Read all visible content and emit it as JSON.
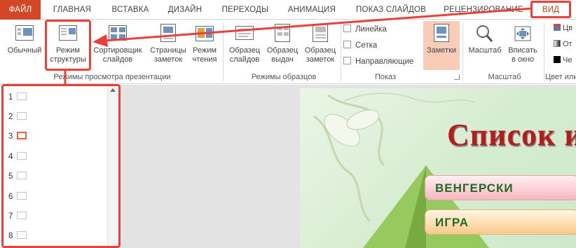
{
  "tabs": [
    "ФАЙЛ",
    "ГЛАВНАЯ",
    "ВСТАВКА",
    "ДИЗАЙН",
    "ПЕРЕХОДЫ",
    "АНИМАЦИЯ",
    "ПОКАЗ СЛАЙДОВ",
    "РЕЦЕНЗИРОВАНИЕ",
    "ВИД"
  ],
  "ribbon": {
    "view_modes": {
      "normal": "Обычный",
      "outline_1": "Режим",
      "outline_2": "структуры",
      "sorter_1": "Сортировщик",
      "sorter_2": "слайдов",
      "notes_page_1": "Страницы",
      "notes_page_2": "заметок",
      "reading_1": "Режим",
      "reading_2": "чтения",
      "group_label": "Режимы просмотра презентации"
    },
    "master_views": {
      "slide_master_1": "Образец",
      "slide_master_2": "слайдов",
      "handout_master_1": "Образец",
      "handout_master_2": "выдач",
      "notes_master_1": "Образец",
      "notes_master_2": "заметок",
      "group_label": "Режимы образцов"
    },
    "show": {
      "ruler": "Линейка",
      "gridlines": "Сетка",
      "guides": "Направляющие",
      "notes": "Заметки",
      "group_label": "Показ"
    },
    "zoom": {
      "zoom": "Масштаб",
      "fit_1": "Вписать",
      "fit_2": "в окно",
      "group_label": "Масштаб"
    },
    "color": {
      "opt1": "Цв",
      "opt2": "От",
      "opt3": "Че",
      "group_label": "Цвет или"
    }
  },
  "outline": {
    "slides": [
      "1",
      "2",
      "3",
      "4",
      "5",
      "6",
      "7",
      "8"
    ],
    "selected_slide": "3"
  },
  "slide": {
    "title": "Список и",
    "item1": "ВЕНГЕРСКИ",
    "item2": "ИГРА"
  },
  "colors": {
    "file_tab": "#d24726",
    "highlight": "#e8413c",
    "title_red": "#b71c1c",
    "notes_active": "#f8cdb8"
  }
}
